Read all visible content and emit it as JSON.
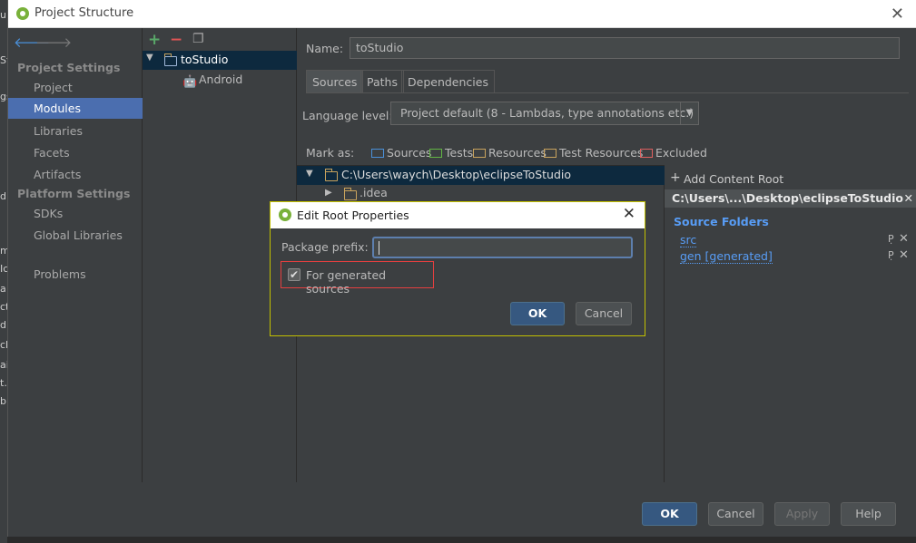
{
  "window": {
    "title": "Project Structure"
  },
  "nav": {
    "sections": [
      {
        "header": "Project Settings",
        "items": [
          "Project",
          "Modules",
          "Libraries",
          "Facets",
          "Artifacts"
        ]
      },
      {
        "header": "Platform Settings",
        "items": [
          "SDKs",
          "Global Libraries"
        ]
      }
    ],
    "selected": "Modules",
    "problems": "Problems"
  },
  "module_tree": {
    "root": "toStudio",
    "child": "Android"
  },
  "module": {
    "name_label": "Name:",
    "name_value": "toStudio",
    "tabs": [
      "Sources",
      "Paths",
      "Dependencies"
    ],
    "active_tab": "Sources",
    "language_label": "Language level:",
    "language_value": "Project default (8 - Lambdas, type annotations etc.)",
    "mark_as_label": "Mark as:",
    "mark_as": [
      {
        "label": "Sources",
        "color": "#4a90d9"
      },
      {
        "label": "Tests",
        "color": "#62b543"
      },
      {
        "label": "Resources",
        "color": "#c9a35d"
      },
      {
        "label": "Test Resources",
        "color": "#c9a35d"
      },
      {
        "label": "Excluded",
        "color": "#e06060"
      }
    ],
    "content_root_path": "C:\\Users\\waych\\Desktop\\eclipseToStudio",
    "child_folder": ".idea"
  },
  "side_panel": {
    "add_content_root": "Add Content Root",
    "root_header": "C:\\Users\\...\\Desktop\\eclipseToStudio",
    "source_folders_label": "Source Folders",
    "source_folders": [
      "src",
      "gen [generated]"
    ]
  },
  "dialog": {
    "title": "Edit Root Properties",
    "package_prefix_label": "Package prefix:",
    "package_prefix_value": "",
    "generated_label": "For generated sources",
    "generated_checked": true,
    "ok": "OK",
    "cancel": "Cancel"
  },
  "buttons": {
    "ok": "OK",
    "cancel": "Cancel",
    "apply": "Apply",
    "help": "Help"
  },
  "colors": {
    "accent": "#4b6eaf",
    "selection": "#0d293e",
    "link": "#589df6",
    "highlight": "#e53f3f"
  }
}
